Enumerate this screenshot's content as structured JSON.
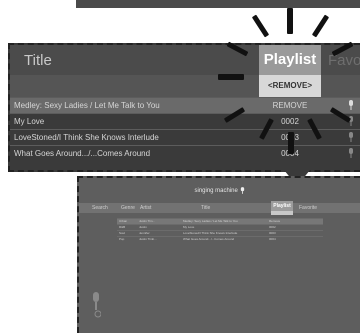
{
  "zoom": {
    "col_title": "Title",
    "col_playlist": "Playlist",
    "col_favorites": "Favorit",
    "remove_header": "<REMOVE>",
    "rows": [
      {
        "title": "Medley: Sexy Ladies / Let Me Talk to You",
        "value": "REMOVE"
      },
      {
        "title": "My Love",
        "value": "0002"
      },
      {
        "title": "LoveStoned/I Think She Knows Interlude",
        "value": "0003"
      },
      {
        "title": "What Goes Around.../...Comes Around",
        "value": "0004"
      }
    ]
  },
  "screen": {
    "brand": "singing machine",
    "header": [
      "Search",
      "Genre",
      "Artist",
      "Title"
    ],
    "playlist": "Playlist",
    "favorites": "Favorite",
    "rows": [
      {
        "genre": "Urban",
        "artist": "Justin Tim...",
        "title": "Medley: Sexy Ladies / Let Me Talk to You",
        "value": "Remove"
      },
      {
        "genre": "R&B",
        "artist": "Justin",
        "title": "My Love",
        "value": "0002"
      },
      {
        "genre": "Soul",
        "artist": "Jennifer",
        "title": "LoveStoned/I Think She Knows Interlude",
        "value": "0003"
      },
      {
        "genre": "Pop",
        "artist": "Justin Timb...",
        "title": "What Goes Around.../...Comes Around",
        "value": "0004"
      }
    ]
  }
}
